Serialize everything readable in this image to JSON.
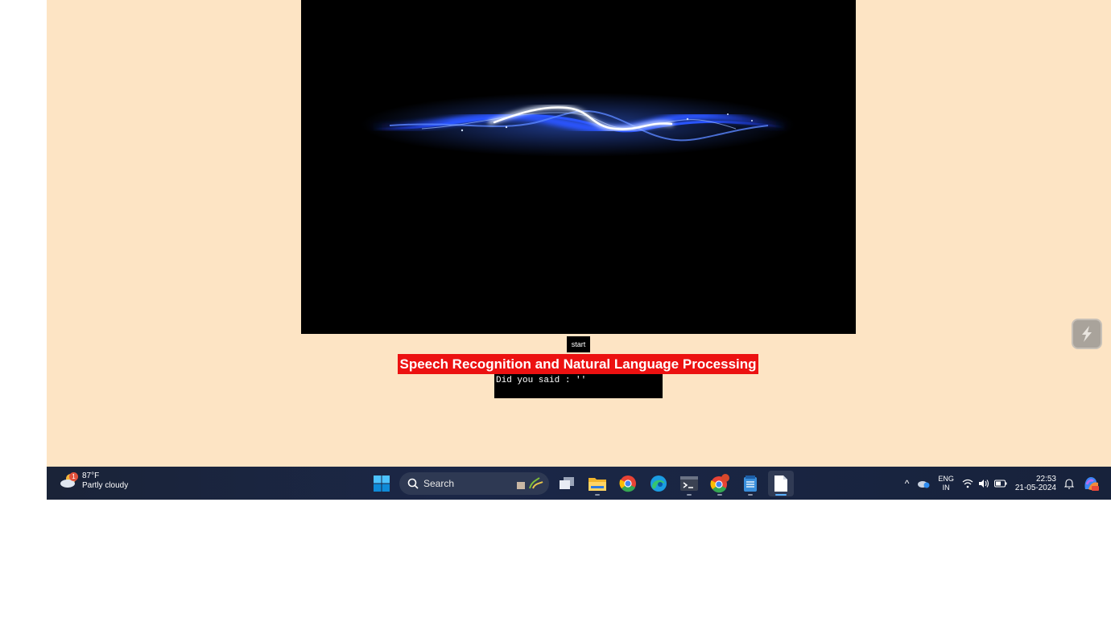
{
  "app": {
    "start_label": "start",
    "title": "Speech Recognition and Natural Language Processing",
    "output_text": "Did you said :  ''"
  },
  "taskbar": {
    "weather_temp": "87°F",
    "weather_desc": "Partly cloudy",
    "weather_badge": "1",
    "search_label": "Search",
    "lang_line1": "ENG",
    "lang_line2": "IN",
    "time": "22:53",
    "date": "21-05-2024"
  },
  "colors": {
    "app_bg": "#fde4c4",
    "title_bg": "#ec1111",
    "taskbar_bg": "#1b2747",
    "wave": "#3a6cff"
  }
}
